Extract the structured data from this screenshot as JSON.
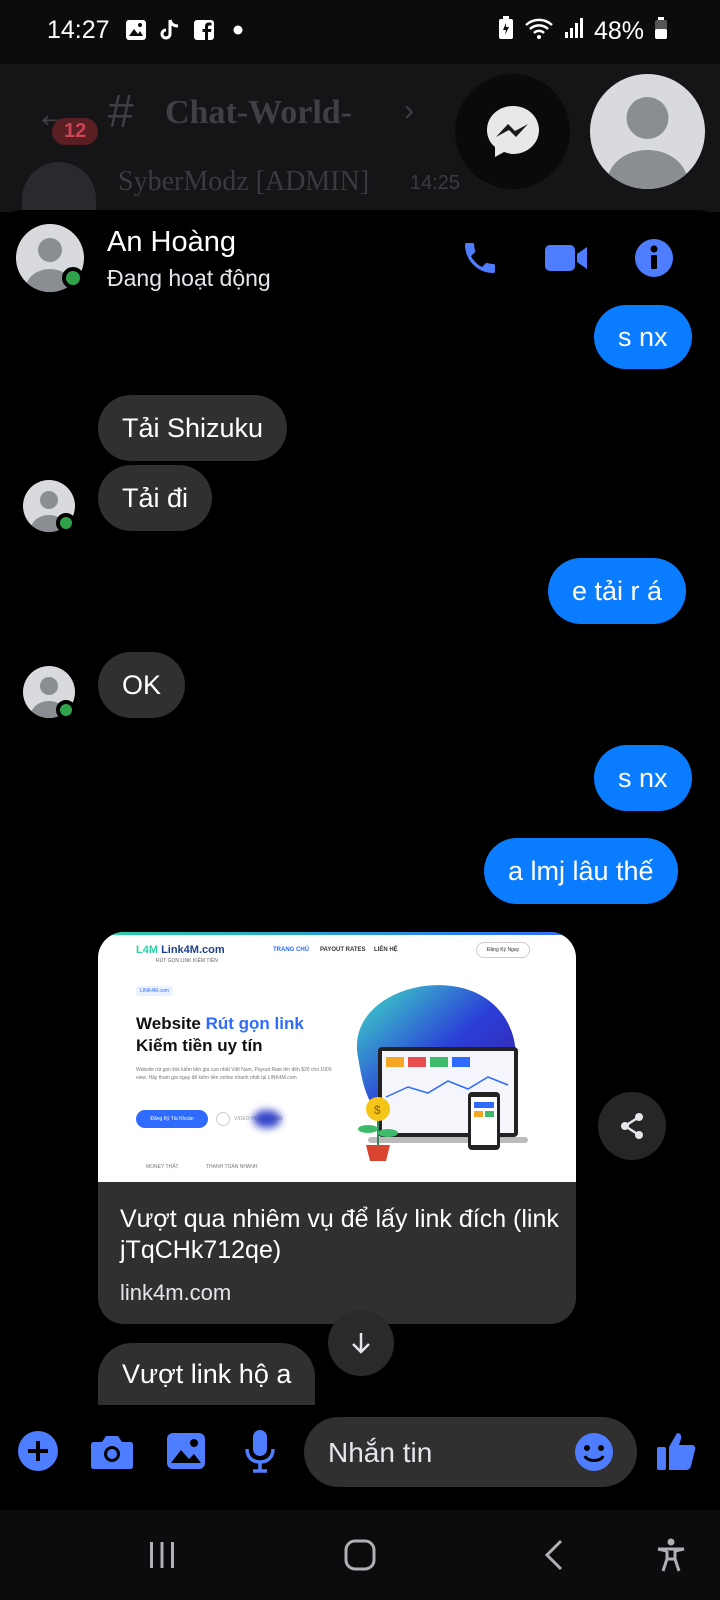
{
  "status_bar": {
    "time": "14:27",
    "battery": "48%"
  },
  "background_app": {
    "badge": "12",
    "channel_title": "Chat-World-",
    "message_author": "SyberModz [ADMIN]",
    "message_time": "14:25"
  },
  "chat_header": {
    "name": "An Hoàng",
    "status": "Đang hoạt động"
  },
  "messages": [
    {
      "from": "me",
      "text": "s nx"
    },
    {
      "from": "them",
      "text": "Tải Shizuku"
    },
    {
      "from": "them",
      "text": "Tải đi"
    },
    {
      "from": "me",
      "text": "e tải r á"
    },
    {
      "from": "them",
      "text": "OK"
    },
    {
      "from": "me",
      "text": "s nx"
    },
    {
      "from": "me",
      "text": "a lmj lâu thế"
    },
    {
      "from": "them",
      "text": "Vượt link hộ a"
    }
  ],
  "link_card": {
    "title": "Vượt qua nhiêm vụ để lấy link đích (link jTqCHk712qe)",
    "domain": "link4m.com",
    "preview": {
      "logo": "Link4M.com",
      "logo_sub": "RÚT GỌN LINK KIẾM TIỀN",
      "nav": [
        "TRANG CHỦ",
        "PAYOUT RATES",
        "LIÊN HỆ"
      ],
      "register": "Đăng Ký Ngay",
      "tag": "LINK4M.com",
      "headline_1": "Website",
      "headline_highlight": "Rút gọn link",
      "headline_2": "Kiếm tiền uy tín",
      "body": "Website rút gọn link kiếm tiền giá cao nhất Việt Nam, Payout Rate lên đến $20 cho 1000 view. Hãy tham gia ngay để kiếm tiền online nhanh nhất tại LINK4M.com",
      "cta": "Đăng Ký Tài Khoản",
      "video": "VIDEO HƯỚNG DẪN",
      "footer_1": "MONEY THẬT",
      "footer_2": "THANH TOÁN NHANH"
    }
  },
  "composer": {
    "placeholder": "Nhắn tin"
  },
  "colors": {
    "accent": "#0a7cff",
    "icon_blue": "#4f7dff",
    "bubble_them": "#303030",
    "online": "#31a24c"
  }
}
